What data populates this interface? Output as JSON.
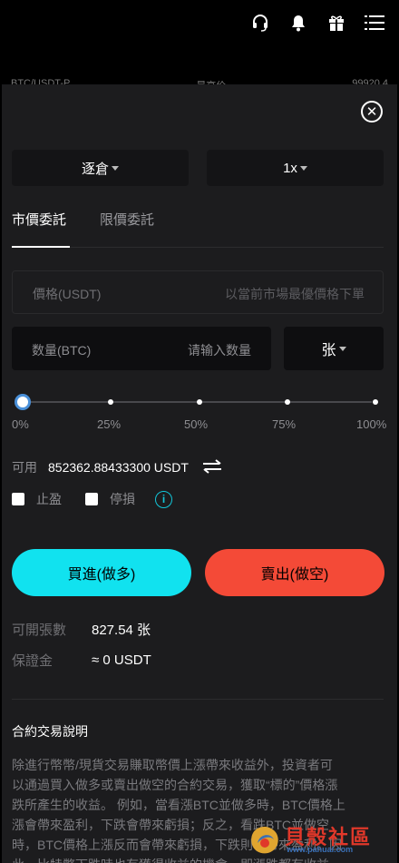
{
  "behind": {
    "left": "BTC/USDT-P",
    "center": "最高价",
    "right": "99920.4"
  },
  "header_icons": [
    "headset-icon",
    "bell-icon",
    "gift-icon",
    "menu-icon"
  ],
  "selectors": {
    "margin_mode": "逐倉",
    "leverage": "1x"
  },
  "tabs": [
    {
      "label": "市價委託",
      "active": true
    },
    {
      "label": "限價委託",
      "active": false
    }
  ],
  "price_field": {
    "label": "價格(USDT)",
    "placeholder": "以當前市場最優價格下單"
  },
  "quantity_field": {
    "label": "数量(BTC)",
    "placeholder": "请输入数量"
  },
  "unit": "张",
  "slider": {
    "value_percent": 0,
    "ticks": [
      "0%",
      "25%",
      "50%",
      "75%",
      "100%"
    ]
  },
  "available": {
    "label": "可用",
    "value": "852362.88433300 USDT"
  },
  "options": {
    "take_profit": "止盈",
    "stop_loss": "停損",
    "info_icon": "i"
  },
  "buttons": {
    "buy": "買進(做多)",
    "sell": "賣出(做空)"
  },
  "stats": {
    "openable_label": "可開張數",
    "openable_value": "827.54 张",
    "margin_label": "保證金",
    "margin_value": "≈ 0 USDT"
  },
  "description": {
    "title": "合約交易說明",
    "lines": [
      "除進行幣幣/現貨交易賺取幣價上漲帶來收益外，投資者可",
      "以通過買入做多或賣出做空的合約交易，獲取“標的”價格漲",
      "跌所產生的收益。 例如，當看漲BTC並做多時，BTC價格上",
      "漲會帶來盈利，下跌會帶來虧損；反之，看跌BTC並做空",
      "時，BTC價格上漲反而會帶來虧損，下跌則會帶來盈利。因",
      "此，比特幣下跌時也有獲得收益的機會，即漲跌都有收益"
    ]
  },
  "watermark": {
    "text": "貝殼社區",
    "sub": "www.pahuai.com"
  },
  "colors": {
    "buy": "#11e2ef",
    "sell": "#f44a37",
    "accent": "#12c5d8"
  }
}
